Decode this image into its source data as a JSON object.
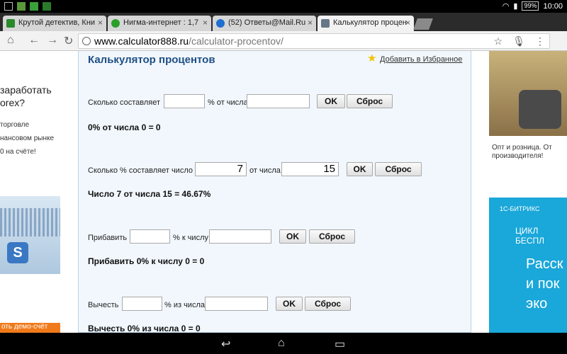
{
  "statusbar": {
    "battery": "99%",
    "time": "10:00"
  },
  "tabs": [
    {
      "label": "Крутой детектив, Кни",
      "favicon_color": "#2a8a2a"
    },
    {
      "label": "Нигма-интернет : 1,7",
      "favicon_color": "#2aa02a"
    },
    {
      "label": "(52) Ответы@Mail.Ru",
      "favicon_color": "#1e6fd1"
    },
    {
      "label": "Калькулятор процен",
      "favicon_color": "#667788"
    }
  ],
  "omnibox": {
    "host": "www.calculator888.ru",
    "path": "/calculator-procentov/"
  },
  "left_ad": {
    "line1": "заработать",
    "line2": "orex?",
    "small1": "торговле",
    "small2": "нансовом рынке",
    "small3": "0 на счёте!",
    "cta": "оть демо-счёт"
  },
  "page": {
    "title": "Калькулятор процентов",
    "favorites_link": "Добавить в Избранное",
    "calc1": {
      "label1": "Сколько составляет",
      "label2": "% от числа",
      "value1": "",
      "value2": "",
      "ok": "OK",
      "reset": "Сброс",
      "result": "0% от числа 0 = 0"
    },
    "calc2": {
      "label1": "Сколько % составляет число",
      "label2": "от числа",
      "value1": "7",
      "value2": "15",
      "ok": "OK",
      "reset": "Сброс",
      "result": "Число 7 от числа 15 = 46.67%"
    },
    "calc3": {
      "label1": "Прибавить",
      "label2": "% к числу",
      "value1": "",
      "value2": "",
      "ok": "OK",
      "reset": "Сброс",
      "result": "Прибавить 0% к числу 0 = 0"
    },
    "calc4": {
      "label1": "Вычесть",
      "label2": "% из числа",
      "value1": "",
      "value2": "",
      "ok": "OK",
      "reset": "Сброс",
      "result": "Вычесть 0% из числа 0 = 0"
    }
  },
  "right_ad": {
    "caption1": "Опт и розница. От",
    "caption2": "производителя!",
    "bitrix_logo": "1С-БИТРИКС",
    "bitrix_cycle": "ЦИКЛ БЕСПЛ",
    "bitrix_big1": "Расск",
    "bitrix_big2": "и пок",
    "bitrix_big3": "эко"
  }
}
